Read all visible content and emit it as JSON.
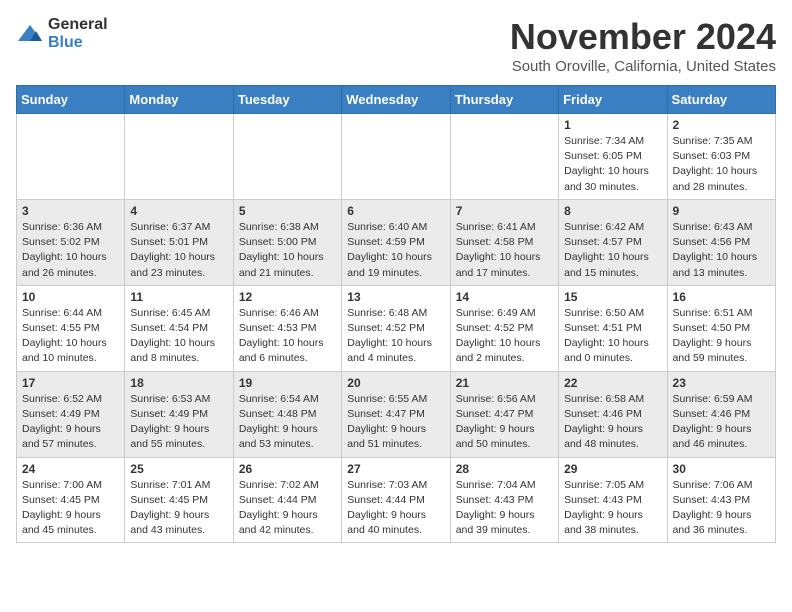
{
  "logo": {
    "general": "General",
    "blue": "Blue"
  },
  "title": "November 2024",
  "location": "South Oroville, California, United States",
  "days_of_week": [
    "Sunday",
    "Monday",
    "Tuesday",
    "Wednesday",
    "Thursday",
    "Friday",
    "Saturday"
  ],
  "weeks": [
    [
      {
        "day": "",
        "info": ""
      },
      {
        "day": "",
        "info": ""
      },
      {
        "day": "",
        "info": ""
      },
      {
        "day": "",
        "info": ""
      },
      {
        "day": "",
        "info": ""
      },
      {
        "day": "1",
        "info": "Sunrise: 7:34 AM\nSunset: 6:05 PM\nDaylight: 10 hours\nand 30 minutes."
      },
      {
        "day": "2",
        "info": "Sunrise: 7:35 AM\nSunset: 6:03 PM\nDaylight: 10 hours\nand 28 minutes."
      }
    ],
    [
      {
        "day": "3",
        "info": "Sunrise: 6:36 AM\nSunset: 5:02 PM\nDaylight: 10 hours\nand 26 minutes."
      },
      {
        "day": "4",
        "info": "Sunrise: 6:37 AM\nSunset: 5:01 PM\nDaylight: 10 hours\nand 23 minutes."
      },
      {
        "day": "5",
        "info": "Sunrise: 6:38 AM\nSunset: 5:00 PM\nDaylight: 10 hours\nand 21 minutes."
      },
      {
        "day": "6",
        "info": "Sunrise: 6:40 AM\nSunset: 4:59 PM\nDaylight: 10 hours\nand 19 minutes."
      },
      {
        "day": "7",
        "info": "Sunrise: 6:41 AM\nSunset: 4:58 PM\nDaylight: 10 hours\nand 17 minutes."
      },
      {
        "day": "8",
        "info": "Sunrise: 6:42 AM\nSunset: 4:57 PM\nDaylight: 10 hours\nand 15 minutes."
      },
      {
        "day": "9",
        "info": "Sunrise: 6:43 AM\nSunset: 4:56 PM\nDaylight: 10 hours\nand 13 minutes."
      }
    ],
    [
      {
        "day": "10",
        "info": "Sunrise: 6:44 AM\nSunset: 4:55 PM\nDaylight: 10 hours\nand 10 minutes."
      },
      {
        "day": "11",
        "info": "Sunrise: 6:45 AM\nSunset: 4:54 PM\nDaylight: 10 hours\nand 8 minutes."
      },
      {
        "day": "12",
        "info": "Sunrise: 6:46 AM\nSunset: 4:53 PM\nDaylight: 10 hours\nand 6 minutes."
      },
      {
        "day": "13",
        "info": "Sunrise: 6:48 AM\nSunset: 4:52 PM\nDaylight: 10 hours\nand 4 minutes."
      },
      {
        "day": "14",
        "info": "Sunrise: 6:49 AM\nSunset: 4:52 PM\nDaylight: 10 hours\nand 2 minutes."
      },
      {
        "day": "15",
        "info": "Sunrise: 6:50 AM\nSunset: 4:51 PM\nDaylight: 10 hours\nand 0 minutes."
      },
      {
        "day": "16",
        "info": "Sunrise: 6:51 AM\nSunset: 4:50 PM\nDaylight: 9 hours\nand 59 minutes."
      }
    ],
    [
      {
        "day": "17",
        "info": "Sunrise: 6:52 AM\nSunset: 4:49 PM\nDaylight: 9 hours\nand 57 minutes."
      },
      {
        "day": "18",
        "info": "Sunrise: 6:53 AM\nSunset: 4:49 PM\nDaylight: 9 hours\nand 55 minutes."
      },
      {
        "day": "19",
        "info": "Sunrise: 6:54 AM\nSunset: 4:48 PM\nDaylight: 9 hours\nand 53 minutes."
      },
      {
        "day": "20",
        "info": "Sunrise: 6:55 AM\nSunset: 4:47 PM\nDaylight: 9 hours\nand 51 minutes."
      },
      {
        "day": "21",
        "info": "Sunrise: 6:56 AM\nSunset: 4:47 PM\nDaylight: 9 hours\nand 50 minutes."
      },
      {
        "day": "22",
        "info": "Sunrise: 6:58 AM\nSunset: 4:46 PM\nDaylight: 9 hours\nand 48 minutes."
      },
      {
        "day": "23",
        "info": "Sunrise: 6:59 AM\nSunset: 4:46 PM\nDaylight: 9 hours\nand 46 minutes."
      }
    ],
    [
      {
        "day": "24",
        "info": "Sunrise: 7:00 AM\nSunset: 4:45 PM\nDaylight: 9 hours\nand 45 minutes."
      },
      {
        "day": "25",
        "info": "Sunrise: 7:01 AM\nSunset: 4:45 PM\nDaylight: 9 hours\nand 43 minutes."
      },
      {
        "day": "26",
        "info": "Sunrise: 7:02 AM\nSunset: 4:44 PM\nDaylight: 9 hours\nand 42 minutes."
      },
      {
        "day": "27",
        "info": "Sunrise: 7:03 AM\nSunset: 4:44 PM\nDaylight: 9 hours\nand 40 minutes."
      },
      {
        "day": "28",
        "info": "Sunrise: 7:04 AM\nSunset: 4:43 PM\nDaylight: 9 hours\nand 39 minutes."
      },
      {
        "day": "29",
        "info": "Sunrise: 7:05 AM\nSunset: 4:43 PM\nDaylight: 9 hours\nand 38 minutes."
      },
      {
        "day": "30",
        "info": "Sunrise: 7:06 AM\nSunset: 4:43 PM\nDaylight: 9 hours\nand 36 minutes."
      }
    ]
  ]
}
